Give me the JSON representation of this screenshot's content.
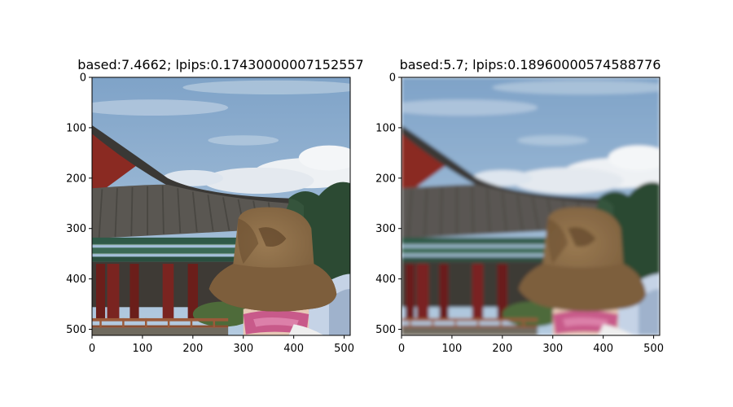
{
  "chart_data": [
    {
      "type": "image",
      "title": "based:7.4662; lpips:0.17430000007152557",
      "xlim": [
        0,
        512
      ],
      "ylim": [
        512,
        0
      ],
      "xticks": [
        0,
        100,
        200,
        300,
        400,
        500
      ],
      "yticks": [
        0,
        100,
        200,
        300,
        400,
        500
      ],
      "xtick_labels": [
        "0",
        "100",
        "200",
        "300",
        "400",
        "500"
      ],
      "ytick_labels": [
        "0",
        "100",
        "200",
        "300",
        "400",
        "500"
      ],
      "image_content": "temple-roof-with-sky-and-person-wearing-brown-hat",
      "grid": false
    },
    {
      "type": "image",
      "title": "based:5.7; lpips:0.18960000574588776",
      "xlim": [
        0,
        512
      ],
      "ylim": [
        512,
        0
      ],
      "xticks": [
        0,
        100,
        200,
        300,
        400,
        500
      ],
      "yticks": [
        0,
        100,
        200,
        300,
        400,
        500
      ],
      "xtick_labels": [
        "0",
        "100",
        "200",
        "300",
        "400",
        "500"
      ],
      "ytick_labels": [
        "0",
        "100",
        "200",
        "300",
        "400",
        "500"
      ],
      "image_content": "temple-roof-with-sky-and-person-wearing-brown-hat",
      "grid": false
    }
  ],
  "colors": {
    "sky_top": "#7fa3c8",
    "sky_bottom": "#a9c4dc",
    "cloud": "#eef1f4",
    "roof_tiles": "#5a5752",
    "roof_dark": "#3a3835",
    "red_wall": "#8a2a22",
    "green_beam": "#2f5a48",
    "pillar": "#6b1e1a",
    "tree": "#2c4a33",
    "hat": "#8a6a44",
    "hat_shadow": "#6e5233",
    "scarf": "#c85a8a",
    "railing": "#9a5a3a"
  }
}
